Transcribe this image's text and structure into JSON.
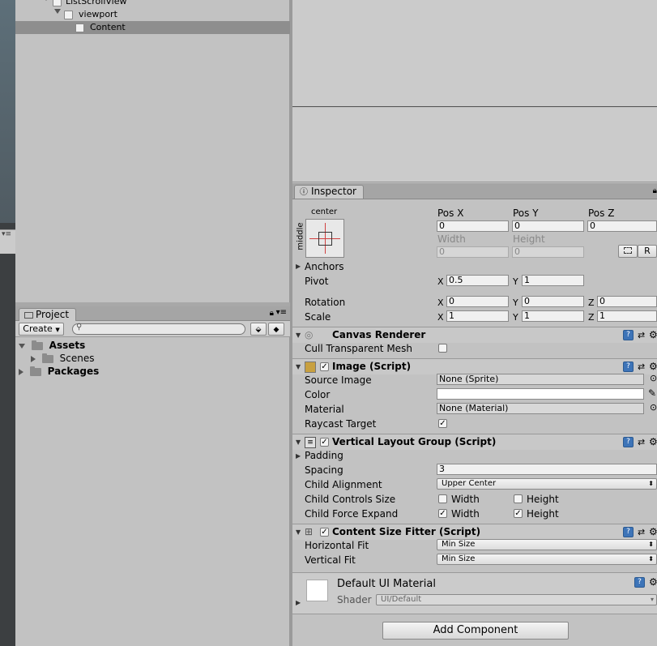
{
  "hierarchy": {
    "items": [
      {
        "label": "ListScrollView"
      },
      {
        "label": "viewport"
      },
      {
        "label": "Content"
      }
    ]
  },
  "project": {
    "tab_label": "Project",
    "create_label": "Create",
    "search_placeholder": "",
    "items": [
      {
        "label": "Assets"
      },
      {
        "label": "Scenes"
      },
      {
        "label": "Packages"
      }
    ]
  },
  "inspector": {
    "tab_label": "Inspector",
    "rect_transform": {
      "anchor_h": "center",
      "anchor_v": "middle",
      "pos_x_label": "Pos X",
      "pos_y_label": "Pos Y",
      "pos_z_label": "Pos Z",
      "pos_x": "0",
      "pos_y": "0",
      "pos_z": "0",
      "width_label": "Width",
      "height_label": "Height",
      "width": "0",
      "height": "0",
      "raw_button": "R",
      "anchors_label": "Anchors",
      "pivot_label": "Pivot",
      "pivot_x": "0.5",
      "pivot_y": "1",
      "rotation_label": "Rotation",
      "rot_x": "0",
      "rot_y": "0",
      "rot_z": "0",
      "scale_label": "Scale",
      "scale_x": "1",
      "scale_y": "1",
      "scale_z": "1",
      "x": "X",
      "y": "Y",
      "z": "Z"
    },
    "canvas_renderer": {
      "title": "Canvas Renderer",
      "cull_label": "Cull Transparent Mesh",
      "cull_checked": false
    },
    "image": {
      "title": "Image (Script)",
      "source_label": "Source Image",
      "source_value": "None (Sprite)",
      "color_label": "Color",
      "color_value": "#ffffff",
      "material_label": "Material",
      "material_value": "None (Material)",
      "raycast_label": "Raycast Target",
      "raycast_checked": true
    },
    "vlg": {
      "title": "Vertical Layout Group (Script)",
      "padding_label": "Padding",
      "spacing_label": "Spacing",
      "spacing_value": "3",
      "alignment_label": "Child Alignment",
      "alignment_value": "Upper Center",
      "controls_label": "Child Controls Size",
      "force_label": "Child Force Expand",
      "width_label": "Width",
      "height_label": "Height",
      "controls_width": false,
      "controls_height": false,
      "force_width": true,
      "force_height": true
    },
    "csf": {
      "title": "Content Size Fitter (Script)",
      "hfit_label": "Horizontal Fit",
      "hfit_value": "Min Size",
      "vfit_label": "Vertical Fit",
      "vfit_value": "Min Size"
    },
    "material": {
      "name": "Default UI Material",
      "shader_label": "Shader",
      "shader_value": "UI/Default"
    },
    "add_component_label": "Add Component"
  },
  "colors": {
    "panel_bg": "#c2c2c2",
    "selection": "#8e8e8e",
    "help_blue": "#3d74b8"
  }
}
